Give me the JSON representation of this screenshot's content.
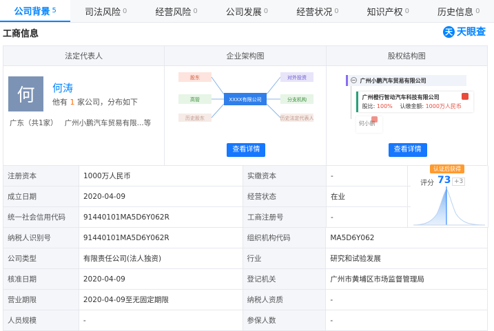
{
  "tabs": [
    {
      "label": "公司背景",
      "count": "5"
    },
    {
      "label": "司法风险",
      "count": "0"
    },
    {
      "label": "经营风险",
      "count": "0"
    },
    {
      "label": "公司发展",
      "count": "0"
    },
    {
      "label": "经营状况",
      "count": "0"
    },
    {
      "label": "知识产权",
      "count": "0"
    },
    {
      "label": "历史信息",
      "count": "0"
    }
  ],
  "section_title": "工商信息",
  "logo": {
    "mark": "天",
    "text": "天眼查"
  },
  "cards": {
    "legal_rep": {
      "header": "法定代表人",
      "avatar_char": "何",
      "name": "何涛",
      "sub_prefix": "他有",
      "sub_count": "1",
      "sub_suffix": "家公司，分布如下",
      "region": "广东（共1家）",
      "company": "广州小鹏汽车贸易有限...等"
    },
    "structure": {
      "header": "企业架构图",
      "left_nodes": [
        "股东",
        "高管",
        "历史股东"
      ],
      "center_node": "XXXX有限公司",
      "right_nodes": [
        "对外投资",
        "分支机构",
        "历史法定代表人"
      ],
      "button": "查看详情"
    },
    "equity": {
      "header": "股权结构图",
      "top_company": "广州小鹏汽车贸易有限公司",
      "child_company": "广州橙行智动汽车科技有限公司",
      "child_ratio_label": "股比:",
      "child_ratio": "100%",
      "child_capital_label": "认缴金额:",
      "child_capital": "1000万人民币",
      "person": "何小鹏",
      "button": "查看详情"
    }
  },
  "score": {
    "badge": "认证后获得",
    "label": "评分",
    "value": "73",
    "delta": "+3"
  },
  "rows": [
    {
      "l1": "注册资本",
      "v1": "1000万人民币",
      "l2": "实缴资本",
      "v2": "-"
    },
    {
      "l1": "成立日期",
      "v1": "2020-04-09",
      "l2": "经营状态",
      "v2": "在业"
    },
    {
      "l1": "统一社会信用代码",
      "v1": "91440101MA5D6Y062R",
      "l2": "工商注册号",
      "v2": "-"
    },
    {
      "l1": "纳税人识别号",
      "v1": "91440101MA5D6Y062R",
      "l2": "组织机构代码",
      "v2": "MA5D6Y062"
    },
    {
      "l1": "公司类型",
      "v1": "有限责任公司(法人独资)",
      "l2": "行业",
      "v2": "研究和试验发展"
    },
    {
      "l1": "核准日期",
      "v1": "2020-04-09",
      "l2": "登记机关",
      "v2": "广州市黄埔区市场监督管理局"
    },
    {
      "l1": "营业期限",
      "v1": "2020-04-09至无固定期限",
      "l2": "纳税人资质",
      "v2": "-"
    },
    {
      "l1": "人员规模",
      "v1": "-",
      "l2": "参保人数",
      "v2": "-"
    }
  ]
}
